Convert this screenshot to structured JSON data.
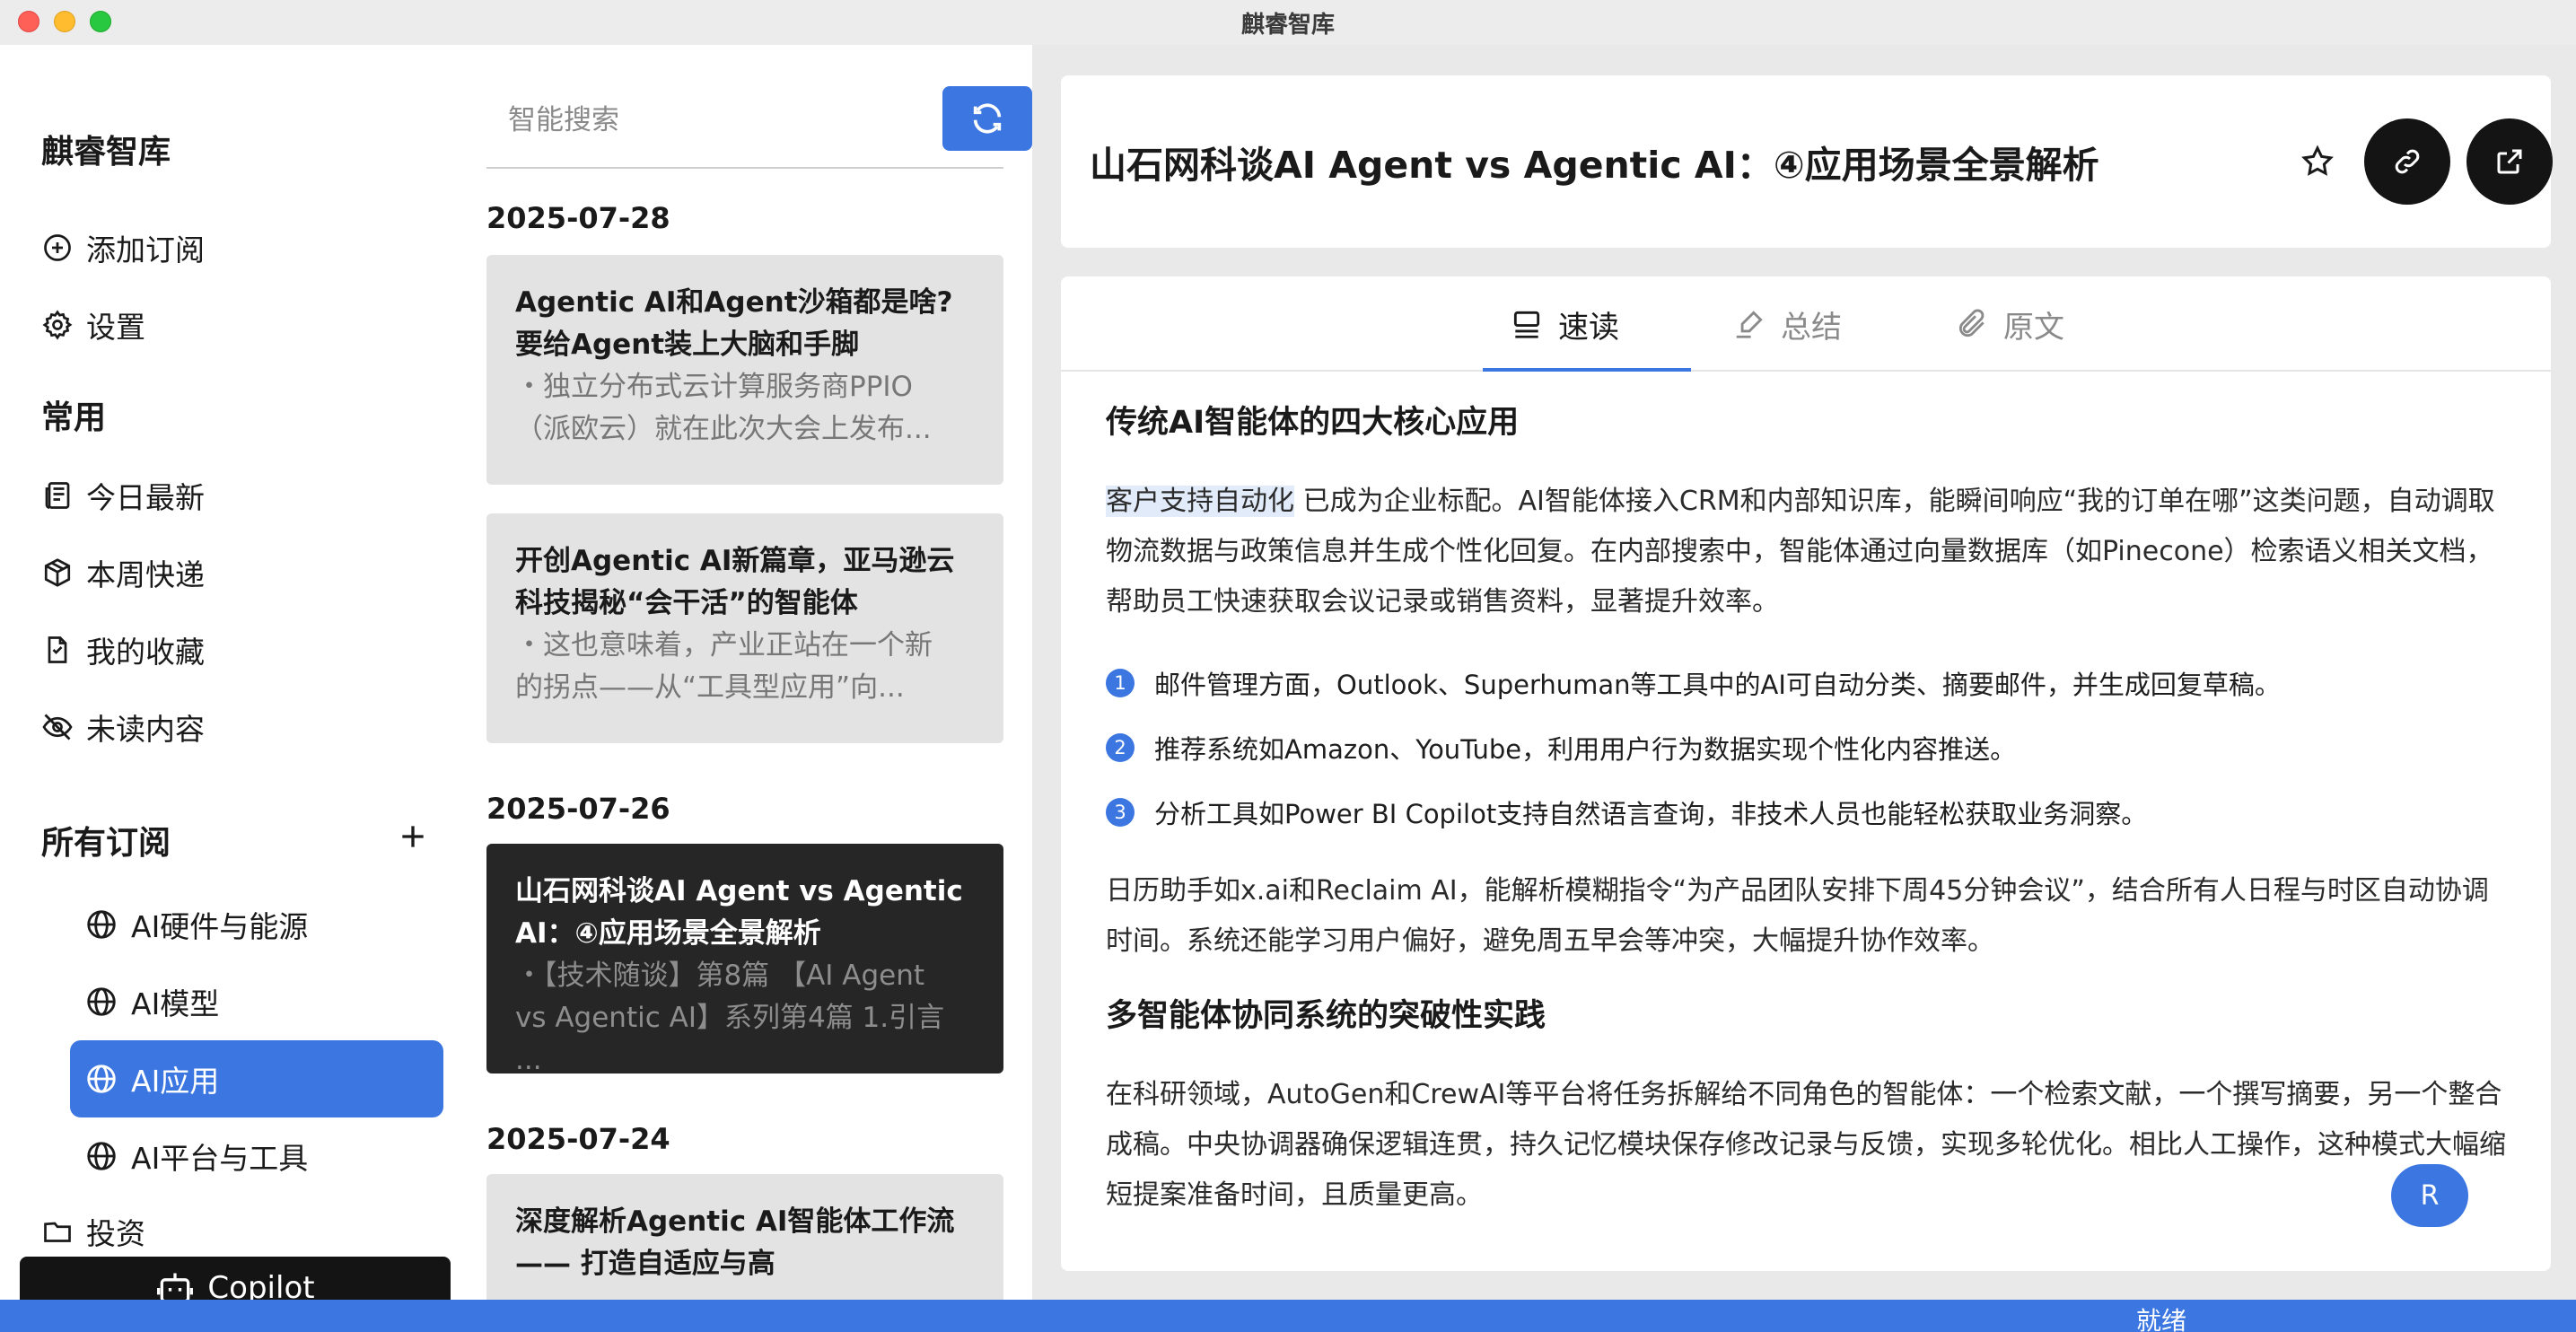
{
  "window": {
    "title": "麒睿智库"
  },
  "sidebar": {
    "brand": "麒睿智库",
    "top_items": [
      {
        "label": "添加订阅",
        "icon": "plus-circle-icon"
      },
      {
        "label": "设置",
        "icon": "gear-icon"
      }
    ],
    "common_title": "常用",
    "common_items": [
      {
        "label": "今日最新",
        "icon": "news-icon"
      },
      {
        "label": "本周快递",
        "icon": "package-icon"
      },
      {
        "label": "我的收藏",
        "icon": "bookmark-file-icon"
      },
      {
        "label": "未读内容",
        "icon": "eye-off-icon"
      }
    ],
    "subs_title": "所有订阅",
    "subs": [
      {
        "label": "AI硬件与能源",
        "active": false
      },
      {
        "label": "AI模型",
        "active": false
      },
      {
        "label": "AI应用",
        "active": true
      },
      {
        "label": "AI平台与工具",
        "active": false
      }
    ],
    "folder": {
      "label": "投资",
      "icon": "folder-icon"
    },
    "copilot_label": "Copilot"
  },
  "list": {
    "search_placeholder": "智能搜索",
    "groups": [
      {
        "date": "2025-07-28"
      },
      {
        "date": "2025-07-26"
      },
      {
        "date": "2025-07-24"
      }
    ],
    "cards": [
      {
        "title_lines": [
          "Agentic AI和Agent沙箱都是啥?",
          "要给Agent装上大脑和手脚"
        ],
        "snippet_lines": [
          "・独立分布式云计算服务商PPIO",
          "（派欧云）就在此次大会上发布..."
        ]
      },
      {
        "title_lines": [
          "开创Agentic AI新篇章，亚马逊云",
          "科技揭秘“会干活”的智能体"
        ],
        "snippet_lines": [
          "・这也意味着，产业正站在一个新",
          "的拐点——从“工具型应用”向..."
        ]
      },
      {
        "title_lines": [
          "山石网科谈AI Agent vs Agentic",
          "AI：④应用场景全景解析"
        ],
        "snippet_lines": [
          "・【技术随谈】第8篇 【AI Agent",
          "vs Agentic AI】系列第4篇 1.引言 ..."
        ]
      },
      {
        "title_lines": [
          "深度解析Agentic AI智能体工作流",
          "—— 打造自适应与高"
        ],
        "snippet_lines": []
      }
    ]
  },
  "article": {
    "title": "山石网科谈AI Agent vs Agentic AI：④应用场景全景解析",
    "tabs": [
      {
        "label": "速读",
        "icon": "reader-icon",
        "active": true
      },
      {
        "label": "总结",
        "icon": "highlighter-icon",
        "active": false
      },
      {
        "label": "原文",
        "icon": "paperclip-icon",
        "active": false
      }
    ],
    "h1": "传统AI智能体的四大核心应用",
    "p1_highlight": "客户支持自动化",
    "p1_rest": " 已成为企业标配。AI智能体接入CRM和内部知识库，能瞬间响应“我的订单在哪”这类问题，自动调取物流数据与政策信息并生成个性化回复。在内部搜索中，智能体通过向量数据库（如Pinecone）检索语义相关文档，帮助员工快速获取会议记录或销售资料，显著提升效率。",
    "list": [
      {
        "num": "1",
        "text": "邮件管理方面，Outlook、Superhuman等工具中的AI可自动分类、摘要邮件，并生成回复草稿。"
      },
      {
        "num": "2",
        "text": "推荐系统如Amazon、YouTube，利用用户行为数据实现个性化内容推送。"
      },
      {
        "num": "3",
        "text": "分析工具如Power BI Copilot支持自然语言查询，非技术人员也能轻松获取业务洞察。"
      }
    ],
    "p2": "日历助手如x.ai和Reclaim AI，能解析模糊指令“为产品团队安排下周45分钟会议”，结合所有人日程与时区自动协调时间。系统还能学习用户偏好，避免周五早会等冲突，大幅提升协作效率。",
    "h2": "多智能体协同系统的突破性实践",
    "p3": "在科研领域，AutoGen和CrewAI等平台将任务拆解给不同角色的智能体：一个检索文献，一个撰写摘要，另一个整合成稿。中央协调器确保逻辑连贯，持久记忆模块保存修改记录与反馈，实现多轮优化。相比人工操作，这种模式大幅缩短提案准备时间，且质量更高。",
    "floating_label": "R"
  },
  "status": {
    "text": "就绪"
  },
  "colors": {
    "accent": "#3b76e1",
    "dark": "#141414"
  }
}
